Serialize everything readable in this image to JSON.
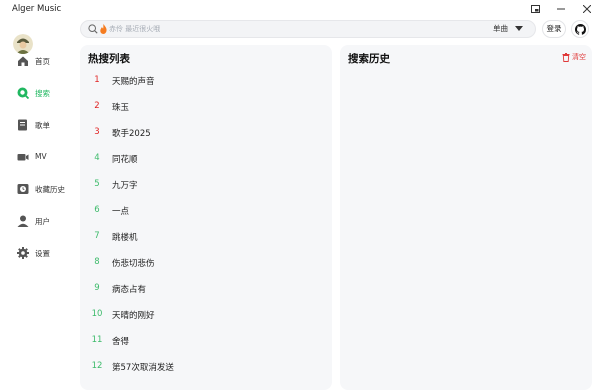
{
  "window": {
    "title": "Alger Music"
  },
  "sidebar": {
    "items": [
      {
        "label": "首页",
        "icon": "home-icon",
        "active": false
      },
      {
        "label": "搜索",
        "icon": "search-nav-icon",
        "active": true
      },
      {
        "label": "歌单",
        "icon": "playlist-icon",
        "active": false
      },
      {
        "label": "MV",
        "icon": "video-icon",
        "active": false
      },
      {
        "label": "收藏历史",
        "icon": "history-icon",
        "active": false
      },
      {
        "label": "用户",
        "icon": "user-icon",
        "active": false
      },
      {
        "label": "设置",
        "icon": "settings-icon",
        "active": false
      }
    ]
  },
  "header": {
    "search_placeholder": "赤伶 最近很火哦",
    "search_type": "单曲",
    "login_label": "登录"
  },
  "hot": {
    "title": "热搜列表",
    "items": [
      {
        "rank": "1",
        "name": "天赐的声音"
      },
      {
        "rank": "2",
        "name": "珠玉"
      },
      {
        "rank": "3",
        "name": "歌手2025"
      },
      {
        "rank": "4",
        "name": "同花顺"
      },
      {
        "rank": "5",
        "name": "九万字"
      },
      {
        "rank": "6",
        "name": "一点"
      },
      {
        "rank": "7",
        "name": "跳楼机"
      },
      {
        "rank": "8",
        "name": "伤悲切悲伤"
      },
      {
        "rank": "9",
        "name": "病态占有"
      },
      {
        "rank": "10",
        "name": "天晴的刚好"
      },
      {
        "rank": "11",
        "name": "舍得"
      },
      {
        "rank": "12",
        "name": "第57次取消发送"
      }
    ]
  },
  "history": {
    "title": "搜索历史",
    "clear_label": "清空"
  },
  "colors": {
    "accent": "#20b760",
    "top_rank": "#e02424",
    "rank": "#3dbb6b",
    "clear": "#e03a3a"
  }
}
